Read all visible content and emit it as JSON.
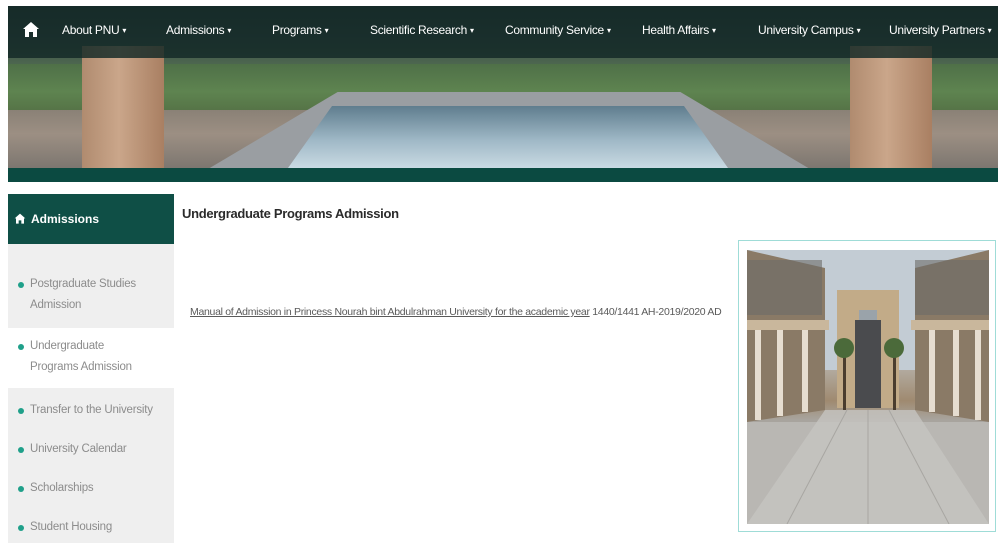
{
  "nav": {
    "home_icon": "home-icon",
    "items": [
      {
        "label": "About PNU"
      },
      {
        "label": "Admissions"
      },
      {
        "label": "Programs"
      },
      {
        "label": "Scientific Research"
      },
      {
        "label": "Community Service"
      },
      {
        "label": "Health Affairs"
      },
      {
        "label": "University Campus"
      },
      {
        "label": "University Partners"
      }
    ],
    "caret": "▾"
  },
  "sidebar": {
    "title": "Admissions",
    "items": [
      {
        "label": "Postgraduate Studies Admission"
      },
      {
        "label": "Undergraduate Programs Admission"
      },
      {
        "label": "Transfer to the University"
      },
      {
        "label": "University Calendar"
      },
      {
        "label": "Scholarships"
      },
      {
        "label": "Student Housing"
      }
    ],
    "active_index": 1
  },
  "main": {
    "title": "Undergraduate Programs Admission",
    "document_link": "Manual of Admission in Princess Nourah bint Abdulrahman University for the academic year",
    "document_suffix": " 1440/1441 AH-2019/2020 AD"
  },
  "colors": {
    "primary": "#0f4f46",
    "bullet": "#1fa08a",
    "frame_border": "#9fdcd7"
  }
}
